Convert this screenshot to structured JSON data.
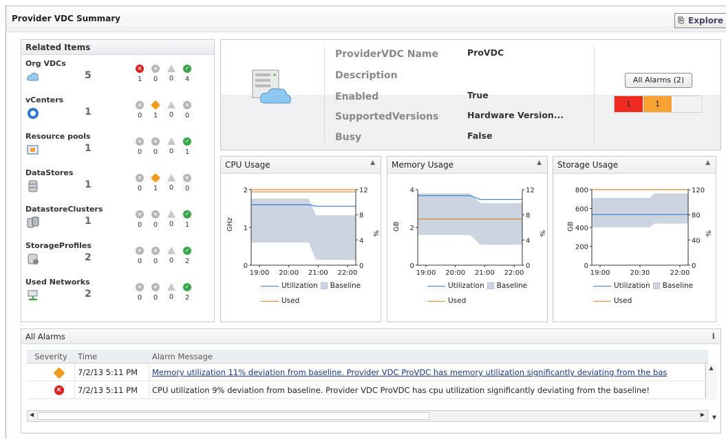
{
  "header": {
    "title": "Provider VDC Summary",
    "explore_label": "Explore"
  },
  "related": {
    "title": "Related Items",
    "items": [
      {
        "label": "Org VDCs",
        "count": "5",
        "icon": "org-vdc-icon",
        "sev": [
          "red",
          "grey",
          "tri",
          "green"
        ],
        "nums": [
          "1",
          "0",
          "0",
          "4"
        ]
      },
      {
        "label": "vCenters",
        "count": "1",
        "icon": "vcenter-icon",
        "sev": [
          "grey",
          "orange",
          "tri",
          "grey"
        ],
        "nums": [
          "0",
          "1",
          "0",
          "0"
        ]
      },
      {
        "label": "Resource pools",
        "count": "1",
        "icon": "resource-pool-icon",
        "sev": [
          "grey",
          "grey",
          "tri",
          "green"
        ],
        "nums": [
          "0",
          "0",
          "0",
          "1"
        ]
      },
      {
        "label": "DataStores",
        "count": "1",
        "icon": "datastore-icon",
        "sev": [
          "grey",
          "orange",
          "tri",
          "grey"
        ],
        "nums": [
          "0",
          "1",
          "0",
          "0"
        ]
      },
      {
        "label": "DatastoreClusters",
        "count": "1",
        "icon": "datastore-cluster-icon",
        "sev": [
          "grey",
          "grey",
          "tri",
          "green"
        ],
        "nums": [
          "0",
          "0",
          "0",
          "1"
        ]
      },
      {
        "label": "StorageProfiles",
        "count": "2",
        "icon": "storage-profile-icon",
        "sev": [
          "grey",
          "grey",
          "tri",
          "green"
        ],
        "nums": [
          "0",
          "0",
          "0",
          "2"
        ]
      },
      {
        "label": "Used Networks",
        "count": "2",
        "icon": "network-icon",
        "sev": [
          "grey",
          "grey",
          "tri",
          "green"
        ],
        "nums": [
          "0",
          "0",
          "0",
          "2"
        ]
      }
    ]
  },
  "info": {
    "name_label": "ProviderVDC Name",
    "name_value": "ProVDC",
    "desc_label": "Description",
    "desc_value": "",
    "enabled_label": "Enabled",
    "enabled_value": "True",
    "versions_label": "SupportedVersions",
    "versions_value": "Hardware Version...",
    "busy_label": "Busy",
    "busy_value": "False",
    "alarms_button": "All Alarms (2)",
    "alarm_counts": [
      {
        "value": "1",
        "color": "#ee2a22"
      },
      {
        "value": "1",
        "color": "#f7a233"
      },
      {
        "value": "",
        "color": "#f2f2f2"
      }
    ]
  },
  "charts": [
    {
      "title": "CPU Usage",
      "left_ticks": [
        "2",
        "1",
        "0"
      ],
      "right_ticks": [
        "12",
        "8",
        "4",
        "0"
      ],
      "left_label": "GHz",
      "right_label": "%",
      "x_ticks": [
        "19:00",
        "20:00",
        "21:00",
        "22:00"
      ]
    },
    {
      "title": "Memory Usage",
      "left_ticks": [
        "4",
        "2",
        "0"
      ],
      "right_ticks": [
        "12",
        "8",
        "4",
        "0"
      ],
      "left_label": "GB",
      "right_label": "%",
      "x_ticks": [
        "19:00",
        "20:00",
        "21:00",
        "22:00"
      ]
    },
    {
      "title": "Storage Usage",
      "left_ticks": [
        "800",
        "600",
        "400",
        "200",
        "0"
      ],
      "right_ticks": [
        "120",
        "80",
        "40",
        "0"
      ],
      "left_label": "GB",
      "right_label": "%",
      "x_ticks": [
        "19:00",
        "20:30",
        "22:00"
      ]
    }
  ],
  "legend": {
    "utilization": "Utilization",
    "baseline": "Baseline",
    "used": "Used"
  },
  "alarms": {
    "title": "All Alarms",
    "info_icon": "i",
    "columns": [
      "Severity",
      "Time",
      "Alarm Message"
    ],
    "rows": [
      {
        "severity": "warning",
        "time": "7/2/13 5:11 PM",
        "message": "Memory utilization 11% deviation from baseline. Provider VDC ProVDC has memory utilization significantly deviating from the bas"
      },
      {
        "severity": "critical",
        "time": "7/2/13 5:11 PM",
        "message": "CPU utilization 9% deviation from baseline. Provider VDC ProVDC has cpu utilization significantly deviating from the baseline!"
      }
    ]
  },
  "colors": {
    "utilization": "#2f7ed8",
    "used": "#e0862c",
    "baseline": "#ccd4e0"
  }
}
